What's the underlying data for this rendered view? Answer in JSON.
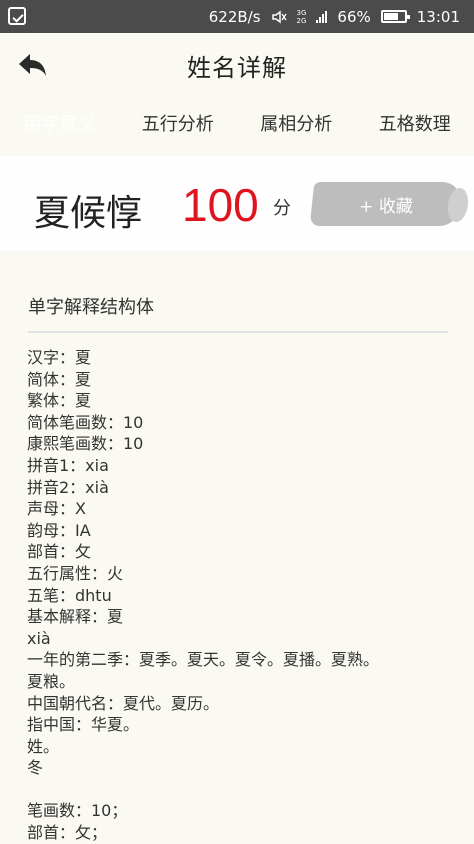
{
  "status_bar": {
    "speed": "622B/s",
    "network_top": "3G",
    "network_bottom": "2G",
    "battery": "66%",
    "time": "13:01"
  },
  "header": {
    "title": "姓名详解",
    "back_icon": "back-arrow-icon"
  },
  "tabs": [
    {
      "label": "用字意义",
      "active": true
    },
    {
      "label": "五行分析",
      "active": false
    },
    {
      "label": "属相分析",
      "active": false
    },
    {
      "label": "五格数理",
      "active": false
    }
  ],
  "name_card": {
    "name": "夏候惇",
    "score": "100",
    "score_unit": "分",
    "favorite_label": "+ 收藏"
  },
  "content": {
    "section_title": "单字解释结构体",
    "lines": [
      "汉字：夏",
      "简体：夏",
      "繁体：夏",
      "简体笔画数：10",
      "康熙笔画数：10",
      "拼音1：xia",
      "拼音2：xià",
      "声母：X",
      "韵母：IA",
      "部首：攵",
      "五行属性：火",
      "五笔：dhtu",
      "基本解释：夏",
      "xià",
      "一年的第二季：夏季。夏天。夏令。夏播。夏熟。",
      "夏粮。",
      "中国朝代名：夏代。夏历。",
      "指中国：华夏。",
      "姓。",
      "冬",
      "",
      "笔画数：10；",
      "部首：攵；"
    ]
  },
  "colors": {
    "status_bar": "#4b4b4b",
    "background": "#fbfaf2",
    "score": "#e0141e",
    "favorite_button": "#bdbdbd",
    "active_tab": "#2b2b2b"
  }
}
